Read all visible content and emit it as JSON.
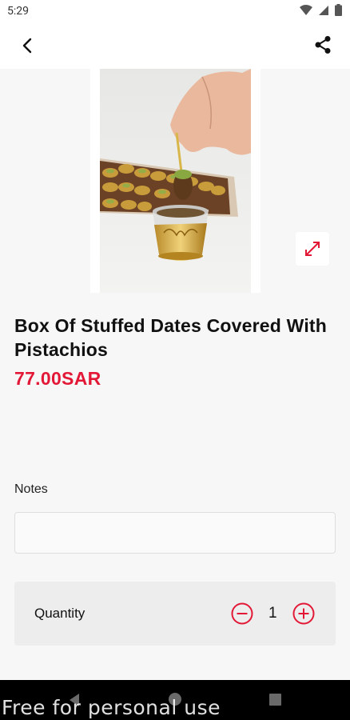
{
  "status_bar": {
    "time": "5:29",
    "icons": [
      "wifi-icon",
      "signal-icon",
      "battery-icon"
    ]
  },
  "app_bar": {
    "back_icon": "chevron-left-icon",
    "share_icon": "share-icon"
  },
  "product": {
    "title": "Box Of Stuffed Dates Covered With Pistachios",
    "price": "77.00SAR",
    "image_icon": "expand-icon"
  },
  "notes": {
    "label": "Notes",
    "value": "",
    "placeholder": ""
  },
  "quantity": {
    "label": "Quantity",
    "value": "1",
    "minus_icon": "minus-circle-icon",
    "plus_icon": "plus-circle-icon"
  },
  "nav_bar": {
    "icons": [
      "nav-back-icon",
      "nav-home-icon",
      "nav-recents-icon"
    ]
  },
  "watermark": "Free for personal use",
  "colors": {
    "accent": "#e31837",
    "background": "#f7f7f7",
    "quantity_bg": "#ededed"
  }
}
